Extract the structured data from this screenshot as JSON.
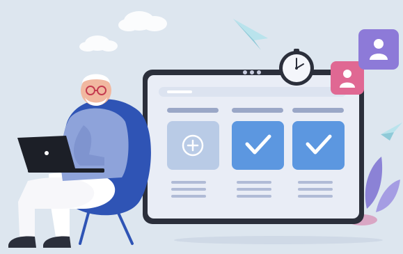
{
  "colors": {
    "background": "#dde6ef",
    "screen_frame": "#2b2f3b",
    "screen_face": "#e9edf6",
    "card_light": "#b9cbe6",
    "card_check": "#5c97e0",
    "bar": "#9aa7c7",
    "chair": "#2f54b5",
    "shirt": "#8ea3da",
    "pants": "#ffffff",
    "avatar_pink": "#e06893",
    "avatar_purple": "#8d7ad8",
    "plane": "#9fd3de",
    "leaf": "#8b82d6"
  },
  "icons": {
    "add": "plus-circle-icon",
    "done": "check-icon",
    "user": "user-avatar-icon",
    "clock": "clock-icon",
    "plane": "paper-plane-icon",
    "laptop": "laptop-icon"
  },
  "cards": [
    {
      "state": "add"
    },
    {
      "state": "done"
    },
    {
      "state": "done"
    }
  ]
}
